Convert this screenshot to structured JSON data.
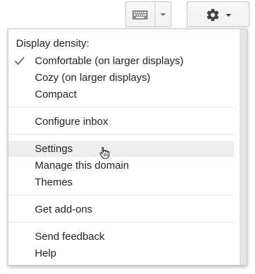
{
  "toolbar": {
    "keyboard_icon": "keyboard-icon",
    "keyboard_caret_icon": "chevron-down-icon",
    "settings_icon": "gear-icon",
    "settings_caret_icon": "chevron-down-icon"
  },
  "menu": {
    "density_label": "Display density:",
    "density_options": [
      {
        "label": "Comfortable (on larger displays)",
        "checked": true
      },
      {
        "label": "Cozy (on larger displays)",
        "checked": false
      },
      {
        "label": "Compact",
        "checked": false
      }
    ],
    "configure_inbox": "Configure inbox",
    "settings": "Settings",
    "manage_domain": "Manage this domain",
    "themes": "Themes",
    "get_addons": "Get add-ons",
    "send_feedback": "Send feedback",
    "help": "Help",
    "hovered_item": "Settings"
  },
  "colors": {
    "hover_bg": "#eeeeee",
    "text": "#222222",
    "check": "#777777"
  }
}
